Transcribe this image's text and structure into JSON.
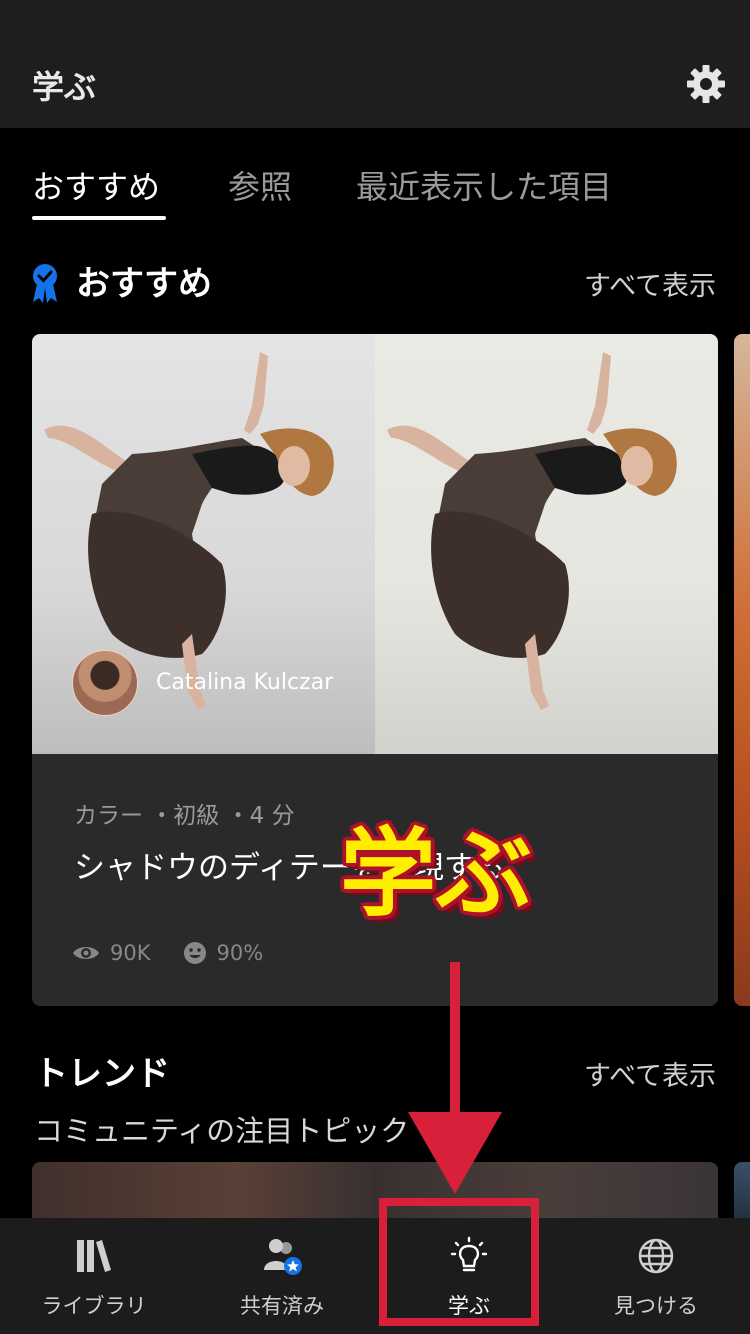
{
  "header": {
    "title": "学ぶ"
  },
  "tabs": [
    {
      "label": "おすすめ"
    },
    {
      "label": "参照"
    },
    {
      "label": "最近表示した項目"
    }
  ],
  "recommended": {
    "title": "おすすめ",
    "see_all": "すべて表示",
    "card": {
      "author": "Catalina Kulczar",
      "meta": "カラー ・初級 ・4 分",
      "title": "シャドウのディテーを表現する",
      "views": "90K",
      "rating": "90%"
    }
  },
  "trending": {
    "title": "トレンド",
    "see_all": "すべて表示",
    "subtitle": "コミュニティの注目トピック"
  },
  "bottom_nav": [
    {
      "label": "ライブラリ",
      "icon": "library-icon"
    },
    {
      "label": "共有済み",
      "icon": "shared-people-icon"
    },
    {
      "label": "学ぶ",
      "icon": "lightbulb-icon"
    },
    {
      "label": "見つける",
      "icon": "globe-icon"
    }
  ],
  "annotation": {
    "text": "学ぶ"
  },
  "colors": {
    "accent_blue": "#1473e6",
    "annotation_red": "#d8203a",
    "annotation_yellow": "#ffee00"
  }
}
